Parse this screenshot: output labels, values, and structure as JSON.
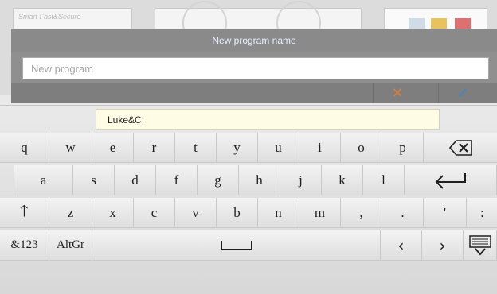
{
  "background": {
    "brand_text": "Smart Fast&Secure"
  },
  "dialog": {
    "title": "New program name",
    "input_placeholder": "New program",
    "cancel_icon": "close-x-icon",
    "confirm_icon": "checkmark-icon",
    "colors": {
      "cancel": "#d87d3e",
      "confirm": "#3d86c6",
      "title": "#e6f0ff"
    }
  },
  "keyboard": {
    "input_value": "Luke&C",
    "rows": [
      [
        "q",
        "w",
        "e",
        "r",
        "t",
        "y",
        "u",
        "i",
        "o",
        "p",
        "backspace-icon"
      ],
      [
        "a",
        "s",
        "d",
        "f",
        "g",
        "h",
        "j",
        "k",
        "l",
        "enter-icon"
      ],
      [
        "shift-icon",
        "z",
        "x",
        "c",
        "v",
        "b",
        "n",
        "m",
        ",",
        ".",
        "'",
        ":"
      ],
      [
        "&123",
        "AltGr",
        "space-icon",
        "left-arrow-icon",
        "right-arrow-icon",
        "hide-keyboard-icon"
      ]
    ],
    "keys": {
      "q": "q",
      "w": "w",
      "e": "e",
      "r": "r",
      "t": "t",
      "y": "y",
      "u": "u",
      "i": "i",
      "o": "o",
      "p": "p",
      "a": "a",
      "s": "s",
      "d": "d",
      "f": "f",
      "g": "g",
      "h": "h",
      "j": "j",
      "k": "k",
      "l": "l",
      "z": "z",
      "x": "x",
      "c": "c",
      "v": "v",
      "b": "b",
      "n": "n",
      "m": "m",
      "comma": ",",
      "period": ".",
      "apostrophe": "'",
      "colon": ":",
      "sym": "&123",
      "altgr": "AltGr"
    }
  }
}
